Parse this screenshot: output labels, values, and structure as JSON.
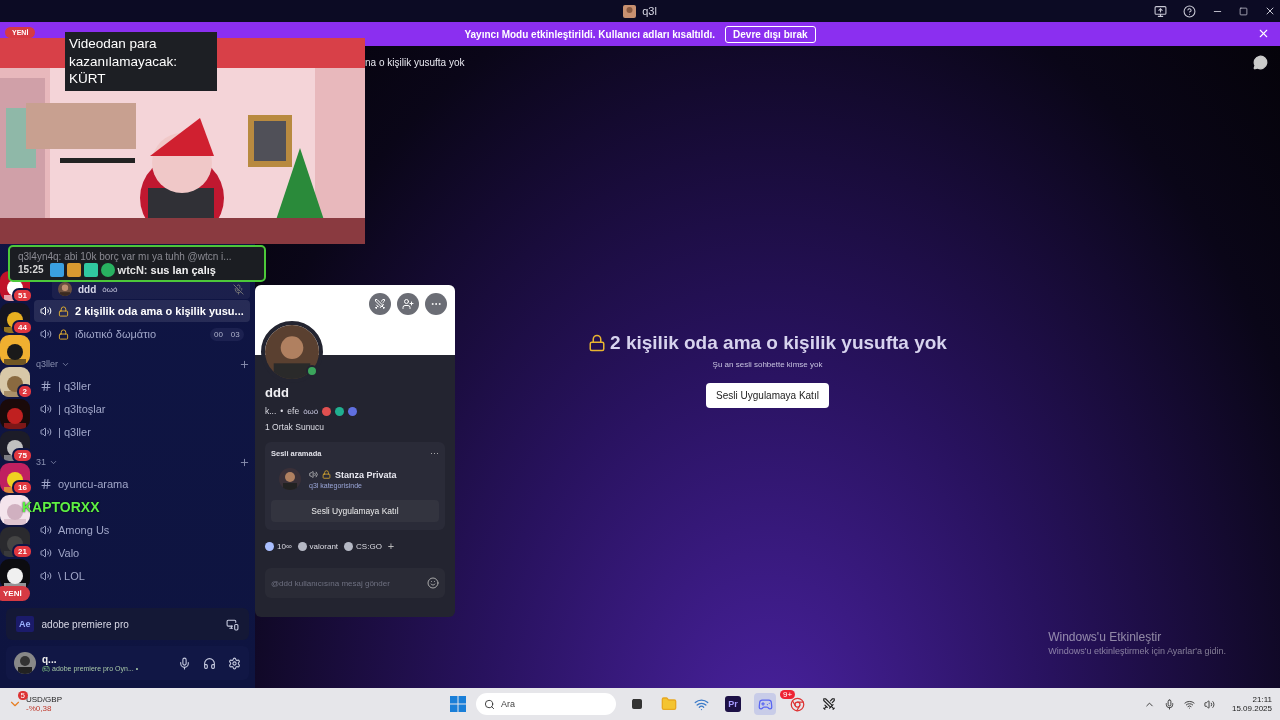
{
  "window": {
    "title": "q3l"
  },
  "banner": {
    "message": "Yayıncı Modu etkinleştirildi. Kullanıcı adları kısaltıldı.",
    "button": "Devre dışı bırak"
  },
  "new_pill": "YENİ",
  "stream_overlay": {
    "tooltip": "Videodan para kazanılamayacak: KÜRT",
    "reply": "q3l4yn4q: abi 10k borç var mı ya tuhh @wtcn i...",
    "time": "15:25",
    "author": "wtcN:",
    "message": "sus lan çalış"
  },
  "servers": [
    {
      "kind": "badged",
      "badge": "51"
    },
    {
      "kind": "badged",
      "badge": "44"
    },
    {
      "kind": "plain"
    },
    {
      "kind": "badged",
      "badge": "2"
    },
    {
      "kind": "plain"
    },
    {
      "kind": "badged",
      "badge": "75"
    },
    {
      "kind": "badged",
      "badge": "16"
    },
    {
      "kind": "plain"
    },
    {
      "kind": "badged",
      "badge": "21"
    },
    {
      "kind": "new",
      "pill": "YENİ"
    }
  ],
  "channel_list": [
    {
      "kind": "user",
      "name": "ddd",
      "tag": "òωó"
    },
    {
      "kind": "voice",
      "name": "2 kişilik oda ama o kişilik yusu...",
      "locked": true,
      "selected": true
    },
    {
      "kind": "voice",
      "name": "ιδιωτικό δωμάτιο",
      "locked": true,
      "selected": false,
      "counts": [
        "00",
        "03"
      ]
    },
    {
      "kind": "category",
      "name": "q3ller",
      "children": [
        {
          "kind": "text",
          "name": "| q3ller",
          "locked": false,
          "selected": false
        },
        {
          "kind": "voice",
          "name": "| q3ltoşlar",
          "locked": false,
          "selected": false
        },
        {
          "kind": "voice",
          "name": "| q3ller",
          "locked": false,
          "selected": false
        }
      ]
    },
    {
      "kind": "category",
      "name": "31",
      "children": [
        {
          "kind": "text",
          "name": "oyuncu-arama",
          "locked": false,
          "selected": false
        },
        {
          "kind": "overlay",
          "name": "KAPTORXX"
        },
        {
          "kind": "voice",
          "name": "Among Us",
          "locked": false,
          "selected": false
        },
        {
          "kind": "voice",
          "name": "Valo",
          "locked": false,
          "selected": false
        },
        {
          "kind": "voice",
          "name": "\\ LOL",
          "locked": false,
          "selected": false
        }
      ]
    }
  ],
  "activity_panel": {
    "app_badge": "Ae",
    "name": "adobe premiere pro"
  },
  "user_panel": {
    "name": "q...",
    "status": "adobe premiere pro Oyn...",
    "separator": "•"
  },
  "header": {
    "title": "na o kişilik yusufta yok"
  },
  "profile_popup": {
    "name": "ddd",
    "subtitle": "k...",
    "dot": "•",
    "pronoun": "efe",
    "tag": "òωó",
    "mutual": "1 Ortak Sunucu",
    "online": true,
    "voice": {
      "heading": "Sesli aramada",
      "more": "···",
      "channel": "Stanza Privata",
      "category": "q3l kategorisinde",
      "button": "Sesli Uygulamaya Katıl"
    },
    "roles": [
      {
        "name": "10∞",
        "color": "#aabfff"
      },
      {
        "name": "valorant",
        "color": "#b5b8c4"
      },
      {
        "name": "CS:GO",
        "color": "#b5b8c4"
      }
    ],
    "add_role": "+",
    "message_placeholder": "@ddd kullanıcısına mesaj gönder"
  },
  "empty_state": {
    "title": "2 kişilik oda ama o kişilik yusufta yok",
    "subtitle": "Şu an sesli sohbette kimse yok",
    "button": "Sesli Uygulamaya Katıl"
  },
  "activation": {
    "title": "Windows'u Etkinleştir",
    "text": "Windows'u etkinleştirmek için Ayarlar'a gidin."
  },
  "taskbar": {
    "widget_badge": "5",
    "widget_title": "USD/GBP",
    "widget_change": "-%0,38",
    "search": "Ara",
    "premiere_label": "Pr",
    "discord_badge": "9+",
    "time": "21:11",
    "date": "15.09.2025"
  }
}
